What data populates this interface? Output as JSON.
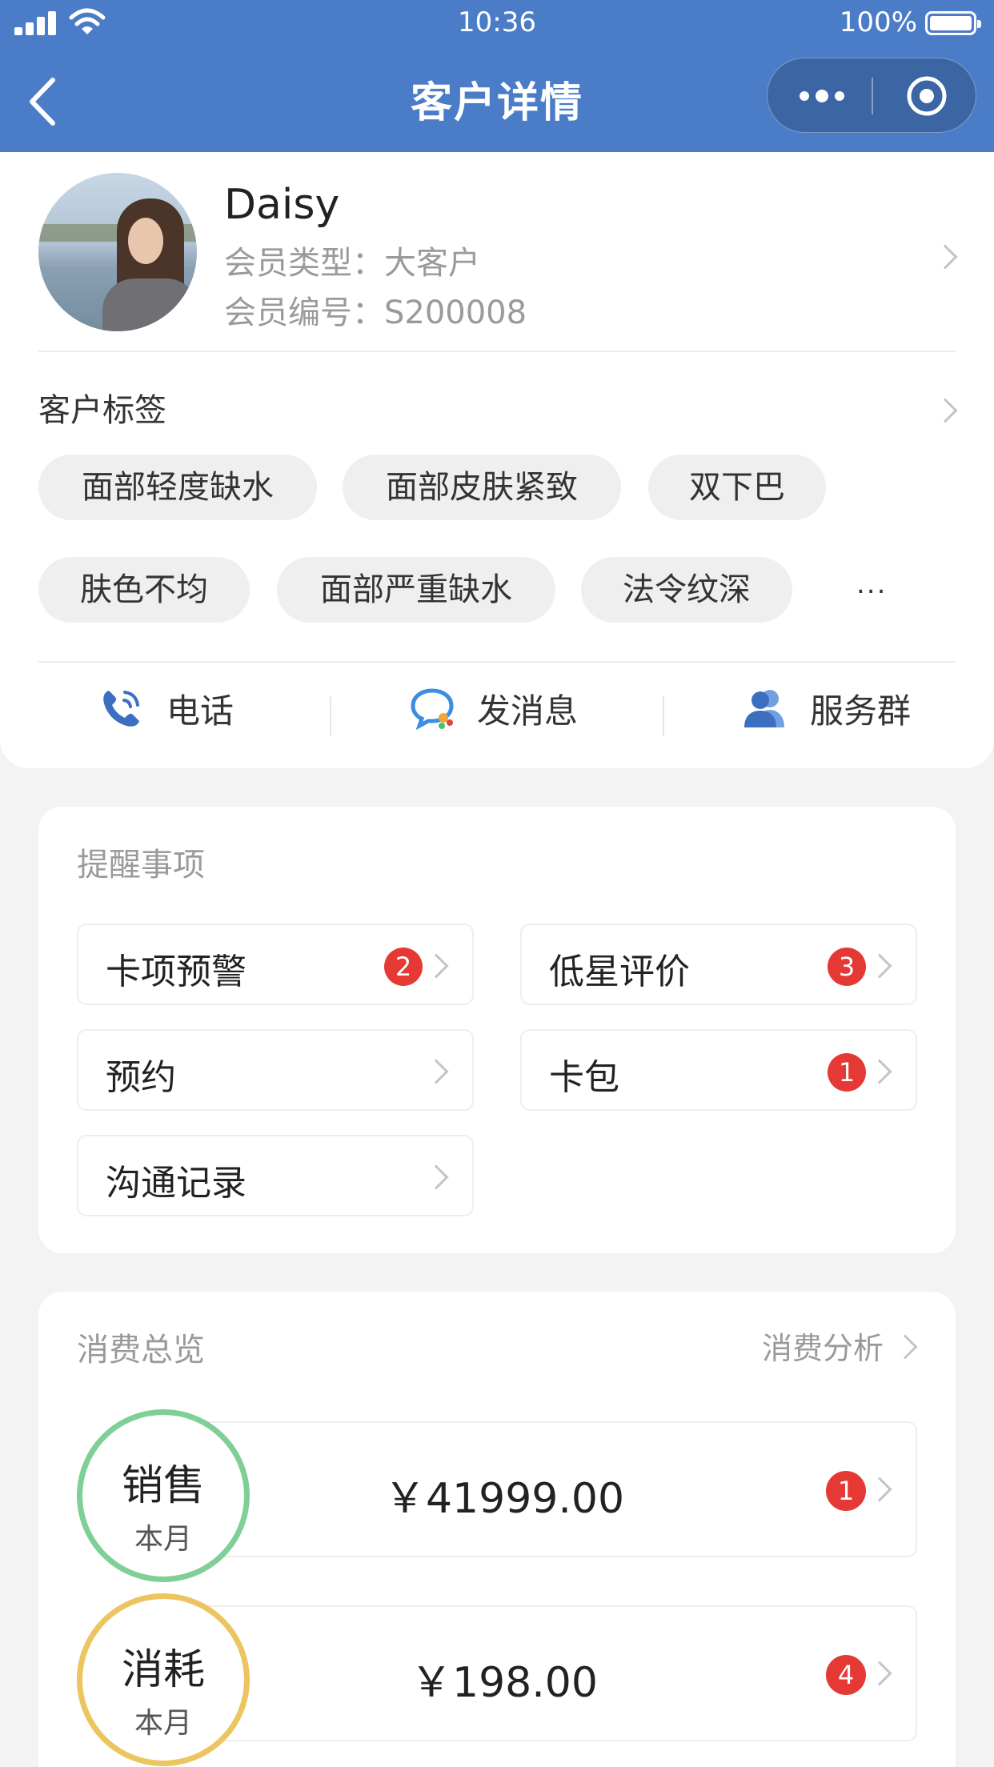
{
  "status_bar": {
    "time": "10:36",
    "battery": "100%"
  },
  "nav": {
    "title": "客户详情"
  },
  "profile": {
    "name": "Daisy",
    "member_type": "会员类型：大客户",
    "member_id": "会员编号：S200008"
  },
  "tags": {
    "title": "客户标签",
    "items": [
      "面部轻度缺水",
      "面部皮肤紧致",
      "双下巴",
      "肤色不均",
      "面部严重缺水",
      "法令纹深"
    ],
    "more": "..."
  },
  "actions": [
    {
      "label": "电话",
      "icon": "phone-icon"
    },
    {
      "label": "发消息",
      "icon": "message-icon"
    },
    {
      "label": "服务群",
      "icon": "group-icon"
    }
  ],
  "reminders": {
    "title": "提醒事项",
    "items": [
      {
        "label": "卡项预警",
        "badge": "2"
      },
      {
        "label": "低星评价",
        "badge": "3"
      },
      {
        "label": "预约"
      },
      {
        "label": "卡包",
        "badge": "1"
      },
      {
        "label": "沟通记录"
      }
    ]
  },
  "consumption": {
    "title": "消费总览",
    "analysis_link": "消费分析",
    "rows": [
      {
        "type": "销售",
        "period": "本月",
        "amount": "￥41999.00",
        "badge": "1",
        "ring_color": "#7fcf96"
      },
      {
        "type": "消耗",
        "period": "本月",
        "amount": "￥198.00",
        "badge": "4",
        "ring_color": "#ecc460"
      }
    ]
  },
  "colors": {
    "primary": "#4a7cc7",
    "badge": "#e53935"
  }
}
